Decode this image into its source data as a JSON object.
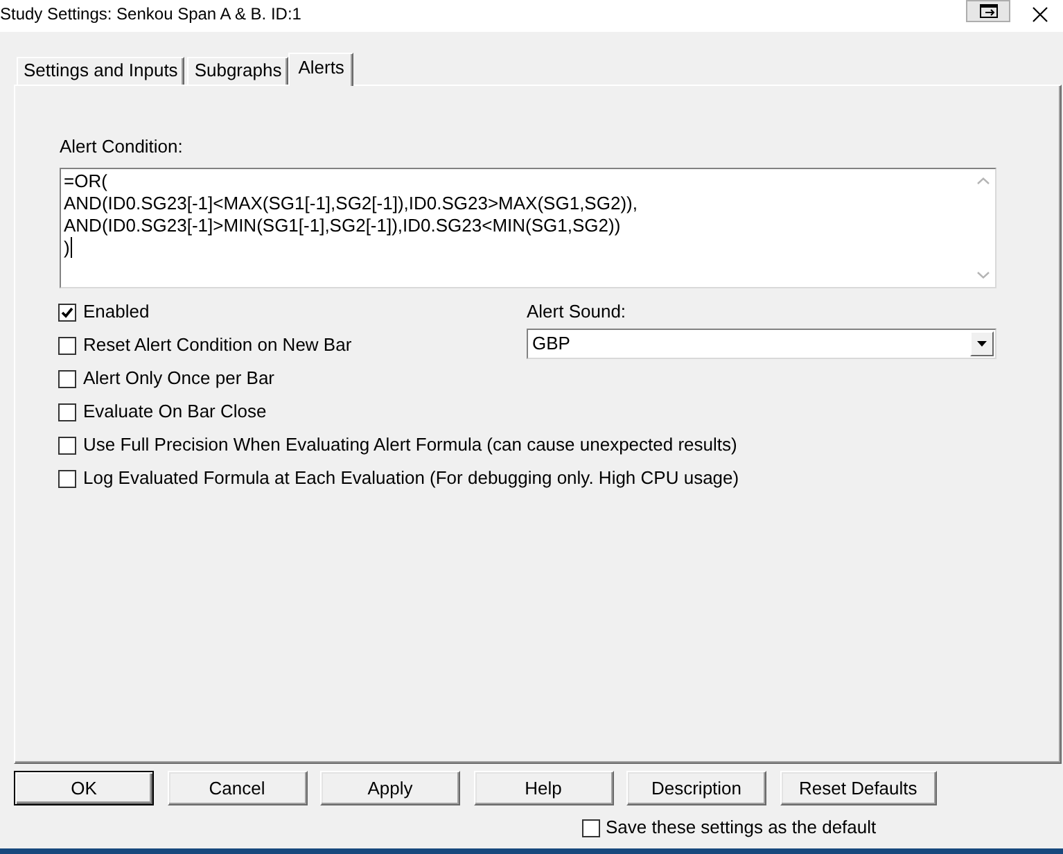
{
  "window": {
    "title": "Study Settings: Senkou Span A & B. ID:1"
  },
  "tabs": [
    {
      "label": "Settings and Inputs",
      "selected": false
    },
    {
      "label": "Subgraphs",
      "selected": false
    },
    {
      "label": "Alerts",
      "selected": true
    }
  ],
  "alert_condition": {
    "label": "Alert Condition:",
    "lines": [
      "=OR(",
      "AND(ID0.SG23[-1]<MAX(SG1[-1],SG2[-1]),ID0.SG23>MAX(SG1,SG2)),",
      "AND(ID0.SG23[-1]>MIN(SG1[-1],SG2[-1]),ID0.SG23<MIN(SG1,SG2))",
      ")"
    ],
    "focused": true
  },
  "options": [
    {
      "label": "Enabled",
      "checked": true
    },
    {
      "label": "Reset Alert Condition on New Bar",
      "checked": false
    },
    {
      "label": "Alert Only Once per Bar",
      "checked": false
    },
    {
      "label": "Evaluate On Bar Close",
      "checked": false
    },
    {
      "label": "Use Full Precision When Evaluating Alert Formula (can cause unexpected results)",
      "checked": false
    },
    {
      "label": "Log Evaluated Formula at Each Evaluation (For debugging only. High CPU usage)",
      "checked": false
    }
  ],
  "alert_sound": {
    "label": "Alert Sound:",
    "value": "GBP"
  },
  "buttons": [
    {
      "label": "OK",
      "default": true
    },
    {
      "label": "Cancel",
      "default": false
    },
    {
      "label": "Apply",
      "default": false
    },
    {
      "label": "Help",
      "default": false
    },
    {
      "label": "Description",
      "default": false
    },
    {
      "label": "Reset Defaults",
      "default": false
    }
  ],
  "save_default": {
    "label": "Save these settings as the default",
    "checked": false
  }
}
